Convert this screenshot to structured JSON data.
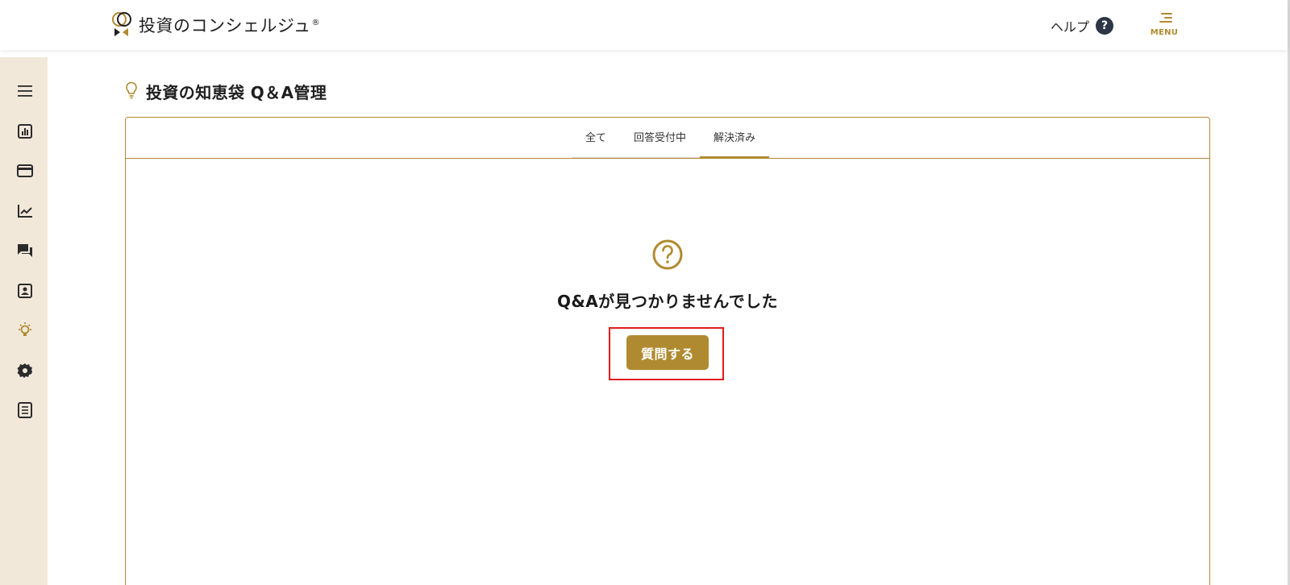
{
  "header": {
    "logo_text": "投資のコンシェルジュ",
    "logo_mark_symbol": "®",
    "help_label": "ヘルプ",
    "help_badge": "?",
    "menu_label": "MENU"
  },
  "sidebar": {
    "items": [
      {
        "icon": "hamburger-icon",
        "active": false
      },
      {
        "icon": "bar-chart-icon",
        "active": false
      },
      {
        "icon": "credit-card-icon",
        "active": false
      },
      {
        "icon": "trending-up-icon",
        "active": false
      },
      {
        "icon": "chat-bubbles-icon",
        "active": false
      },
      {
        "icon": "contact-card-icon",
        "active": false
      },
      {
        "icon": "lightbulb-icon",
        "active": true
      },
      {
        "icon": "gear-icon",
        "active": false
      },
      {
        "icon": "document-list-icon",
        "active": false
      }
    ]
  },
  "page": {
    "title": "投資の知恵袋 Q＆A管理",
    "title_icon": "lightbulb-outline-icon"
  },
  "tabs": [
    {
      "label": "全て",
      "active": false
    },
    {
      "label": "回答受付中",
      "active": false
    },
    {
      "label": "解決済み",
      "active": true
    }
  ],
  "empty_state": {
    "icon": "question-circle-icon",
    "message": "Q&Aが見つかりませんでした",
    "button_label": "質問する"
  },
  "colors": {
    "accent": "#b08a30",
    "sidebar_bg": "#f1e8da",
    "help_badge_bg": "#2c3645",
    "highlight": "#e21b1b"
  }
}
